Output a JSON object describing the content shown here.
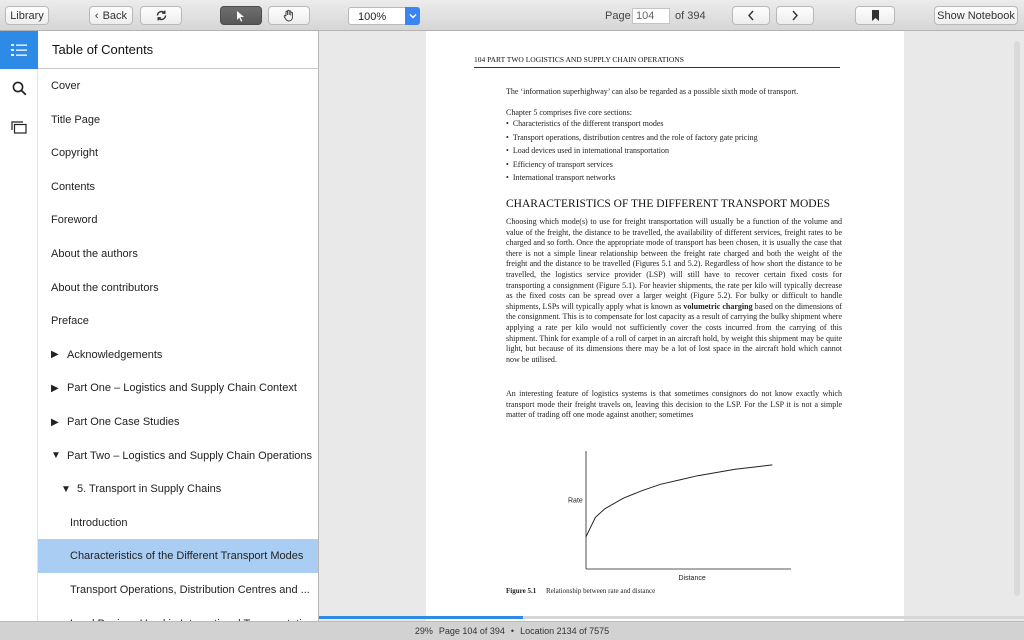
{
  "toolbar": {
    "library_label": "Library",
    "back_label": "Back",
    "zoom_value": "100%",
    "page_label": "Page",
    "page_value": "104",
    "page_total": "of 394",
    "show_notebook_label": "Show Notebook"
  },
  "toc": {
    "title": "Table of Contents",
    "items": [
      {
        "label": "Cover",
        "indent": 0,
        "tri": ""
      },
      {
        "label": "Title Page",
        "indent": 0,
        "tri": ""
      },
      {
        "label": "Copyright",
        "indent": 0,
        "tri": ""
      },
      {
        "label": "Contents",
        "indent": 0,
        "tri": ""
      },
      {
        "label": "Foreword",
        "indent": 0,
        "tri": ""
      },
      {
        "label": "About the authors",
        "indent": 0,
        "tri": ""
      },
      {
        "label": "About the contributors",
        "indent": 0,
        "tri": ""
      },
      {
        "label": "Preface",
        "indent": 0,
        "tri": ""
      },
      {
        "label": "Acknowledgements",
        "indent": 0,
        "tri": "▶"
      },
      {
        "label": "Part One – Logistics and Supply Chain Context",
        "indent": 0,
        "tri": "▶"
      },
      {
        "label": "Part One Case Studies",
        "indent": 0,
        "tri": "▶"
      },
      {
        "label": "Part Two – Logistics and Supply Chain Operations",
        "indent": 0,
        "tri": "▼"
      },
      {
        "label": "5. Transport in Supply Chains",
        "indent": 1,
        "tri": "▼"
      },
      {
        "label": "Introduction",
        "indent": 2,
        "tri": ""
      },
      {
        "label": "Characteristics of the Different Transport Modes",
        "indent": 2,
        "tri": "",
        "selected": true
      },
      {
        "label": "Transport Operations, Distribution Centres and ...",
        "indent": 2,
        "tri": ""
      },
      {
        "label": "Load Devices Used in International Transportation",
        "indent": 2,
        "tri": ""
      }
    ]
  },
  "page": {
    "header": "104   PART TWO   LOGISTICS AND SUPPLY CHAIN OPERATIONS",
    "intro": "The ‘information superhighway’ can also be regarded as a possible sixth mode of transport.",
    "sections_intro": "Chapter 5 comprises five core sections:",
    "bullets": [
      "Characteristics of the different transport modes",
      "Transport operations, distribution centres and the role of factory gate pricing",
      "Load devices used in international transportation",
      "Efficiency of transport services",
      "International transport networks"
    ],
    "heading": "CHARACTERISTICS OF THE DIFFERENT TRANSPORT MODES",
    "para1_a": "Choosing which mode(s) to use for freight transportation will usually be a function of the volume and value of the freight, the distance to be travelled, the availability of different services, freight rates to be charged and so forth. Once the appropriate mode of transport has been chosen, it is usually the case that there is not a simple linear relationship between the freight rate charged and both the weight of the freight and the distance to be travelled (Figures 5.1 and 5.2). Regardless of how short the distance to be travelled, the logistics service provider (LSP) will still have to recover certain fixed costs for transporting a consignment (Figure 5.1). For heavier shipments, the rate per kilo will typically decrease as the fixed costs can be spread over a larger weight (Figure 5.2). For bulky or difficult to handle shipments, LSPs will typically apply what is known as ",
    "para1_bold": "volumetric charging",
    "para1_b": " based on the dimensions of the consignment. This is to compensate for lost capacity as a result of carrying the bulky shipment where applying a rate per kilo would not sufficiently cover the costs incurred from the carrying of this shipment. Think for example of a roll of carpet in an aircraft hold, by weight this shipment may be quite light, but because of its dimensions there may be a lot of lost space in the aircraft hold which cannot now be utilised.",
    "para2": "An interesting feature of logistics systems is that sometimes consignors do not know exactly which transport mode their freight travels on, leaving this decision to the LSP. For the LSP it is not a simple matter of trading off one mode against another; sometimes",
    "figure_caption_num": "Figure 5.1",
    "figure_caption": "Relationship between rate and distance"
  },
  "chart_data": {
    "type": "line",
    "title": "",
    "xlabel": "Distance",
    "ylabel": "Rate",
    "x": [
      0,
      0.05,
      0.1,
      0.2,
      0.3,
      0.4,
      0.5,
      0.6,
      0.7,
      0.8,
      0.9,
      1.0
    ],
    "series": [
      {
        "values": [
          0.3,
          0.48,
          0.56,
          0.66,
          0.73,
          0.79,
          0.83,
          0.87,
          0.9,
          0.93,
          0.95,
          0.97
        ]
      }
    ],
    "xlim": [
      0,
      1.1
    ],
    "ylim": [
      0,
      1.1
    ],
    "grid": false
  },
  "progress": {
    "fraction": 0.29
  },
  "status": {
    "percent": "29%",
    "page_text": "Page 104 of 394",
    "sep": "•",
    "location_text": "Location 2134 of 7575"
  }
}
